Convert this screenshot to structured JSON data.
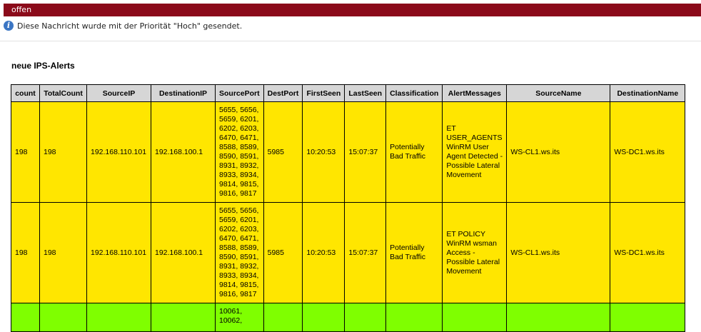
{
  "status": {
    "label": "offen",
    "color": "#8b0a1a"
  },
  "info": {
    "icon": "info-icon",
    "text": "Diese Nachricht wurde mit der Priorität \"Hoch\" gesendet."
  },
  "section": {
    "title": "neue IPS-Alerts"
  },
  "table": {
    "headers": [
      "count",
      "TotalCount",
      "SourceIP",
      "DestinationIP",
      "SourcePort",
      "DestPort",
      "FirstSeen",
      "LastSeen",
      "Classification",
      "AlertMessages",
      "SourceName",
      "DestinationName"
    ],
    "rows": [
      {
        "color": "#ffe600",
        "cells": [
          "198",
          "198",
          "192.168.110.101",
          "192.168.100.1",
          "5655, 5656, 5659, 6201, 6202, 6203, 6470, 6471, 8588, 8589, 8590, 8591, 8931, 8932, 8933, 8934, 9814, 9815, 9816, 9817",
          "5985",
          "10:20:53",
          "15:07:37",
          "Potentially Bad Traffic",
          "ET USER_AGENTS WinRM User Agent Detected - Possible Lateral Movement",
          "WS-CL1.ws.its",
          "WS-DC1.ws.its"
        ]
      },
      {
        "color": "#ffe600",
        "cells": [
          "198",
          "198",
          "192.168.110.101",
          "192.168.100.1",
          "5655, 5656, 5659, 6201, 6202, 6203, 6470, 6471, 8588, 8589, 8590, 8591, 8931, 8932, 8933, 8934, 9814, 9815, 9816, 9817",
          "5985",
          "10:20:53",
          "15:07:37",
          "Potentially Bad Traffic",
          "ET POLICY WinRM wsman Access - Possible Lateral Movement",
          "WS-CL1.ws.its",
          "WS-DC1.ws.its"
        ]
      },
      {
        "color": "#7fff00",
        "cells": [
          "",
          "",
          "",
          "",
          "10061, 10062,",
          "",
          "",
          "",
          "",
          "",
          "",
          ""
        ]
      }
    ]
  }
}
